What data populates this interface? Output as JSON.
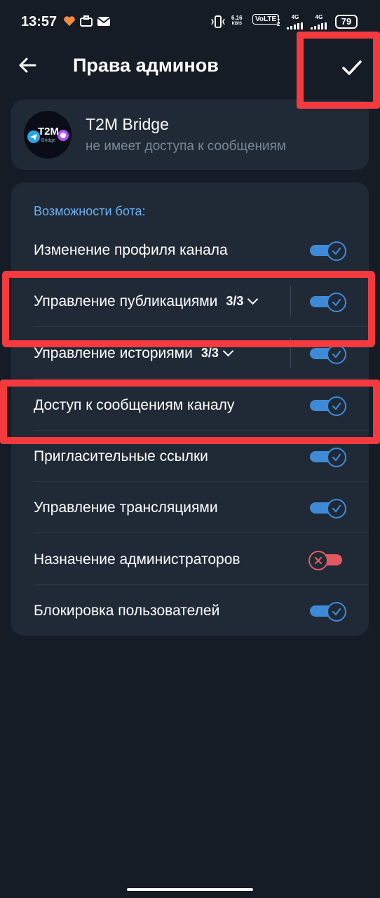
{
  "status_bar": {
    "time": "13:57",
    "net_speed_value": "6.16",
    "net_speed_unit": "KB/S",
    "volte": "VoLTE",
    "sim_slots": [
      "1",
      "2"
    ],
    "signal_1": "4G",
    "signal_2": "4G",
    "battery": "79"
  },
  "header": {
    "title": "Права админов",
    "back_icon": "arrow-left-icon",
    "confirm_icon": "checkmark-icon"
  },
  "bot": {
    "avatar_text": "T2M",
    "avatar_subtext": "Bridge",
    "name": "T2M Bridge",
    "status": "не имеет доступа к сообщениям"
  },
  "permissions": {
    "section_title": "Возможности бота:",
    "items": [
      {
        "label": "Изменение профиля канала",
        "count": "",
        "enabled": true
      },
      {
        "label": "Управление публикациями",
        "count": "3/3",
        "enabled": true
      },
      {
        "label": "Управление историями",
        "count": "3/3",
        "enabled": true
      },
      {
        "label": "Доступ к сообщениям каналу",
        "count": "",
        "enabled": true
      },
      {
        "label": "Пригласительные ссылки",
        "count": "",
        "enabled": true
      },
      {
        "label": "Управление трансляциями",
        "count": "",
        "enabled": true
      },
      {
        "label": "Назначение администраторов",
        "count": "",
        "enabled": false
      },
      {
        "label": "Блокировка пользователей",
        "count": "",
        "enabled": true
      }
    ]
  },
  "colors": {
    "background": "#151c26",
    "card": "#202a37",
    "accent": "#3e8ad6",
    "section_title": "#6ab2f2",
    "toggle_off": "#e05a5f",
    "highlight": "#f43a3f"
  }
}
